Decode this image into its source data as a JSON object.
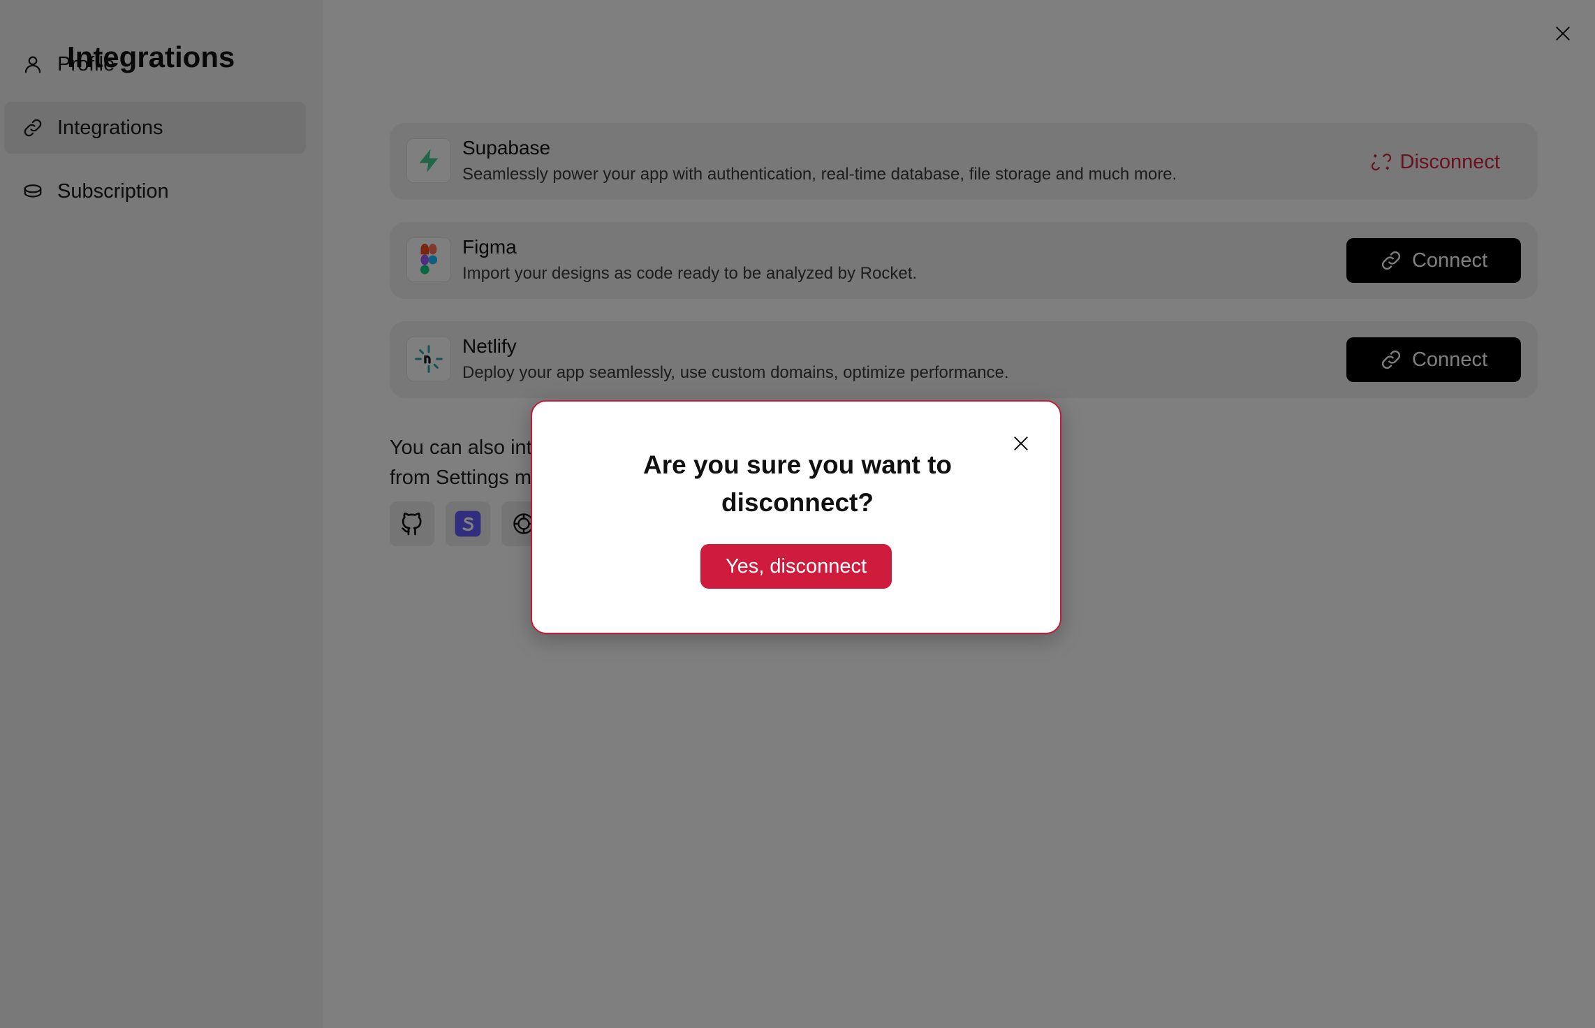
{
  "sidebar": {
    "items": [
      {
        "label": "Profile",
        "icon": "user-icon"
      },
      {
        "label": "Integrations",
        "icon": "link-icon",
        "active": true
      },
      {
        "label": "Subscription",
        "icon": "coin-icon"
      }
    ]
  },
  "main": {
    "title": "Integrations",
    "integrations": [
      {
        "name": "Supabase",
        "description": "Seamlessly power your app with authentication, real-time database, file storage and much more.",
        "action_label": "Disconnect",
        "status": "connected"
      },
      {
        "name": "Figma",
        "description": "Import your designs as code ready to be analyzed by Rocket.",
        "action_label": "Connect",
        "status": "disconnected"
      },
      {
        "name": "Netlify",
        "description": "Deploy your app seamlessly, use custom domains, optimize performance.",
        "action_label": "Connect",
        "status": "disconnected"
      }
    ],
    "more_text_line1": "You can also int",
    "more_text_line2": "from Settings m",
    "more_icons": [
      "github-icon",
      "stripe-icon",
      "openai-icon"
    ]
  },
  "modal": {
    "title": "Are you sure you want to disconnect?",
    "confirm_label": "Yes, disconnect"
  },
  "colors": {
    "accent_red": "#d01c3c",
    "overlay": "rgba(0,0,0,0.5)",
    "supabase_green": "#3ecf8e",
    "netlify_teal": "#25a7a6",
    "stripe_purple": "#635bff"
  }
}
